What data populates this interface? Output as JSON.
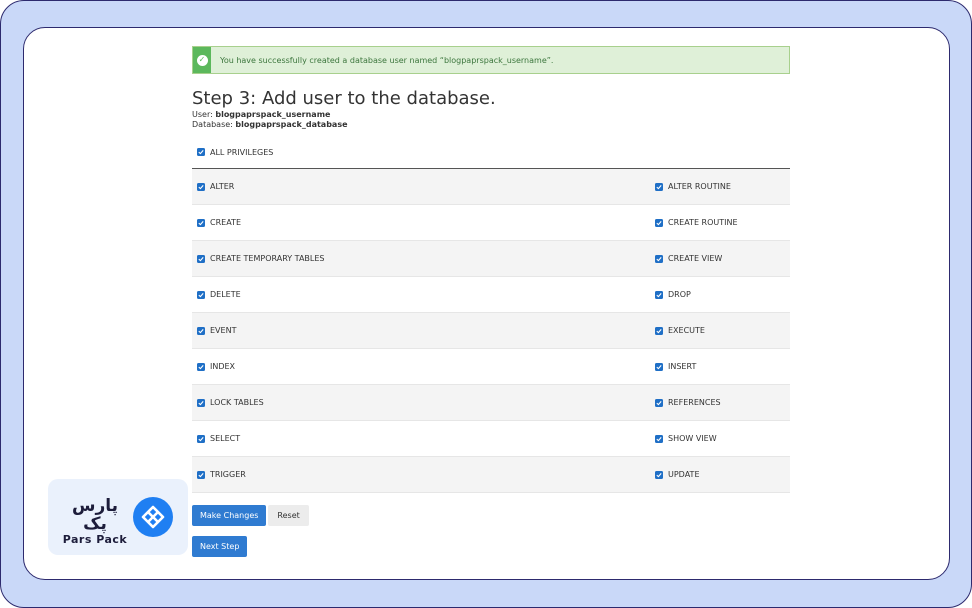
{
  "alert": {
    "message": "You have successfully created a database user named “blogpaprspack_username”."
  },
  "step": {
    "title": "Step 3: Add user to the database.",
    "user_label": "User:",
    "user_value": "blogpaprspack_username",
    "database_label": "Database:",
    "database_value": "blogpaprspack_database"
  },
  "all_privileges": {
    "label": "ALL PRIVILEGES",
    "checked": true
  },
  "privileges": [
    {
      "left": "ALTER",
      "right": "ALTER ROUTINE"
    },
    {
      "left": "CREATE",
      "right": "CREATE ROUTINE"
    },
    {
      "left": "CREATE TEMPORARY TABLES",
      "right": "CREATE VIEW"
    },
    {
      "left": "DELETE",
      "right": "DROP"
    },
    {
      "left": "EVENT",
      "right": "EXECUTE"
    },
    {
      "left": "INDEX",
      "right": "INSERT"
    },
    {
      "left": "LOCK TABLES",
      "right": "REFERENCES"
    },
    {
      "left": "SELECT",
      "right": "SHOW VIEW"
    },
    {
      "left": "TRIGGER",
      "right": "UPDATE"
    }
  ],
  "buttons": {
    "make_changes": "Make Changes",
    "reset": "Reset",
    "next_step": "Next Step"
  },
  "logo": {
    "persian": "پارس پک",
    "english": "Pars Pack",
    "icon": "diamond-grid-icon"
  },
  "colors": {
    "frame_bg": "#c9d8f8",
    "frame_border": "#2d2a6e",
    "alert_bg": "#dff0d8",
    "alert_icon": "#5cb85c",
    "checkbox": "#1f6fc6",
    "primary_button": "#2f7bd1",
    "logo_blue": "#1f7ff2"
  }
}
